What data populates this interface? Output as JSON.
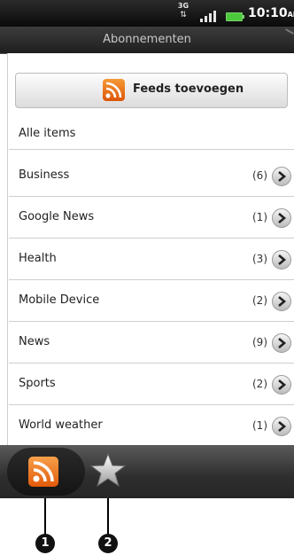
{
  "status_bar": {
    "network": "3G",
    "time": "10:10",
    "time_suffix": "AM"
  },
  "title_bar": {
    "title": "Abonnementen"
  },
  "add_feeds_button": {
    "label": "Feeds toevoegen"
  },
  "all_items": {
    "label": "Alle items"
  },
  "feeds": [
    {
      "label": "Business",
      "count": "(6)"
    },
    {
      "label": "Google News",
      "count": "(1)"
    },
    {
      "label": "Health",
      "count": "(3)"
    },
    {
      "label": "Mobile Device",
      "count": "(2)"
    },
    {
      "label": "News",
      "count": "(9)"
    },
    {
      "label": "Sports",
      "count": "(2)"
    },
    {
      "label": "World weather",
      "count": "(1)"
    }
  ],
  "tabs": [
    {
      "icon": "rss-icon",
      "active": true
    },
    {
      "icon": "star-icon",
      "active": false
    }
  ],
  "callouts": [
    "1",
    "2"
  ],
  "colors": {
    "accent": "#e8670f",
    "tab_bar": "#2e2e2e",
    "status_bar": "#111111"
  }
}
